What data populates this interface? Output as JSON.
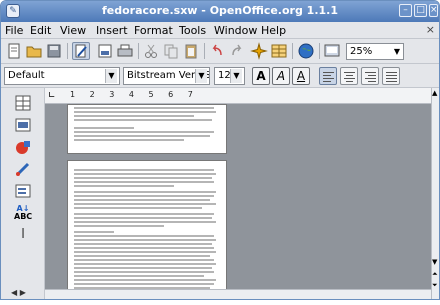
{
  "window": {
    "title": "fedoracore.sxw - OpenOffice.org 1.1.1",
    "controls": [
      "minimize-icon",
      "maximize-icon",
      "close-icon"
    ]
  },
  "menubar": {
    "items": [
      "File",
      "Edit",
      "View",
      "Insert",
      "Format",
      "Tools",
      "Window",
      "Help"
    ],
    "close_doc": "×"
  },
  "toolbar": {
    "zoom_value": "25%"
  },
  "formatting": {
    "paragraph_style": "Default",
    "font_name": "Bitstream Vera Se",
    "font_size": "12",
    "bold_label": "A",
    "italic_label": "A",
    "underline_label": "A"
  },
  "ruler": {
    "numbers": "1 2 3 4 5 6 7"
  },
  "sidebar": {
    "abc_label": "ABC",
    "cursor_label": "I"
  },
  "colors": {
    "titlebar": "#4d79b8",
    "background": "#8f949b"
  }
}
